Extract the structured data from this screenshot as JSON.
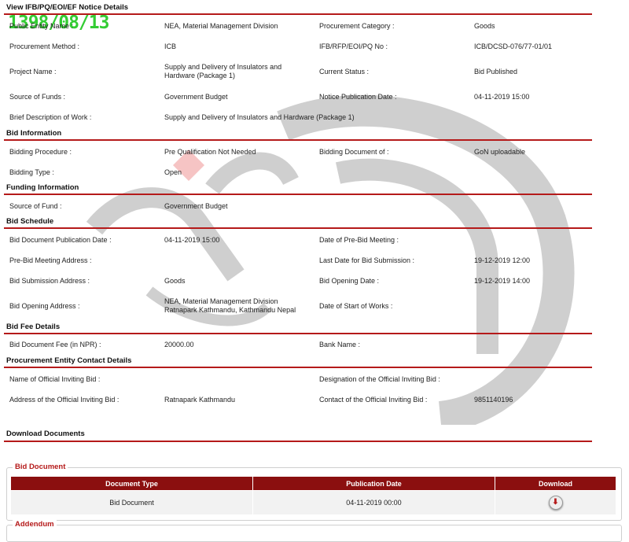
{
  "stamp": "1398/08/13",
  "sections": {
    "notice": "View IFB/PQ/EOI/EF Notice Details",
    "bid_info": "Bid Information",
    "funding": "Funding Information",
    "schedule": "Bid Schedule",
    "fee": "Bid Fee Details",
    "contact": "Procurement Entity Contact Details",
    "download": "Download Documents"
  },
  "notice": {
    "entity_label": "Public Entity Name :",
    "entity_value": "NEA, Material Management Division",
    "category_label": "Procurement Category :",
    "category_value": "Goods",
    "method_label": "Procurement Method :",
    "method_value": "ICB",
    "ifb_label": "IFB/RFP/EOI/PQ No :",
    "ifb_value": "ICB/DCSD-076/77-01/01",
    "project_label": "Project Name :",
    "project_value": "Supply and Delivery of Insulators and Hardware (Package 1)",
    "status_label": "Current Status :",
    "status_value": "Bid Published",
    "funds_label": "Source of Funds :",
    "funds_value": "Government Budget",
    "pubdate_label": "Notice Publication Date :",
    "pubdate_value": "04-11-2019 15:00",
    "brief_label": "Brief Description of Work :",
    "brief_value": "Supply and Delivery of Insulators and Hardware (Package 1)"
  },
  "bid_info": {
    "procedure_label": "Bidding Procedure :",
    "procedure_value": "Pre Qualification Not Needed",
    "doc_of_label": "Bidding Document of :",
    "doc_of_value": "GoN uploadable",
    "type_label": "Bidding Type :",
    "type_value": "Open"
  },
  "funding": {
    "source_label": "Source of Fund :",
    "source_value": "Government Budget"
  },
  "schedule": {
    "pub_label": "Bid Document Publication Date :",
    "pub_value": "04-11-2019 15:00",
    "prebid_date_label": "Date of Pre-Bid Meeting :",
    "prebid_addr_label": "Pre-Bid Meeting Address :",
    "last_date_label": "Last Date for Bid Submission :",
    "last_date_value": "19-12-2019 12:00",
    "sub_addr_label": "Bid Submission Address :",
    "sub_addr_value": "Goods",
    "open_date_label": "Bid Opening Date :",
    "open_date_value": "19-12-2019 14:00",
    "open_addr_label": "Bid Opening Address :",
    "open_addr_value": "NEA, Material Management Division Ratnapark Kathmandu, Kathmandu Nepal",
    "start_label": "Date of Start of Works :"
  },
  "fee": {
    "fee_label": "Bid Document Fee (in NPR) :",
    "fee_value": "20000.00",
    "bank_label": "Bank Name :"
  },
  "contact": {
    "name_label": "Name of Official Inviting Bid :",
    "designation_label": "Designation of the Official Inviting Bid :",
    "address_label": "Address of the Official Inviting Bid :",
    "address_value": "Ratnapark Kathmandu",
    "phone_label": "Contact of the Official Inviting Bid :",
    "phone_value": "9851140196"
  },
  "bid_document": {
    "legend": "Bid Document",
    "columns": [
      "Document Type",
      "Publication Date",
      "Download"
    ],
    "rows": [
      {
        "type": "Bid Document",
        "date": "04-11-2019 00:00",
        "icon": "download-arrow-icon"
      }
    ]
  },
  "addendum": {
    "legend": "Addendum"
  },
  "colors": {
    "accent": "#b51a1a",
    "table_header": "#8b0f0f",
    "stamp": "#33cc33"
  }
}
